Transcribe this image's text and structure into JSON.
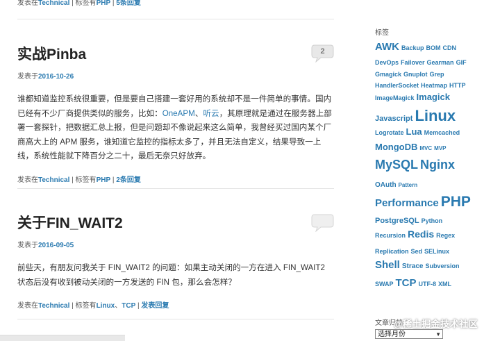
{
  "top_partial": {
    "prefix": "发表在",
    "category": "Technical",
    "tagged": "| 标签有",
    "tag": "PHP",
    "bar": "|",
    "replies": "5条回复"
  },
  "posts": [
    {
      "title_cn": "实战",
      "title_en": "Pinba",
      "date_prefix": "发表于",
      "date": "2016-10-26",
      "comments": "2",
      "excerpt": {
        "part1": "谁都知道监控系统很重要，但是要自己搭建一套好用的系统却不是一件简单的事情。国内已经有不少厂商提供类似的服务，比如：",
        "link1": "OneAPM",
        "sep": "、",
        "link2": "听云",
        "part2": "，其原理就是通过在服务器上部署一套探针，把数据汇总上报，但是问题却不像说起来这么简单，我曾经买过国内某个厂商高大上的 APM 服务，谁知道它监控的指标太多了，并且无法自定义，结果导致一上线，系统性能就下降百分之二十，最后无奈只好放弃。"
      },
      "footer": {
        "prefix": "发表在",
        "category": "Technical",
        "tagged": "| 标签有",
        "tags": [
          "PHP"
        ],
        "bar": "|",
        "replies": "2条回复"
      }
    },
    {
      "title_cn": "关于",
      "title_en": "FIN_WAIT2",
      "date_prefix": "发表于",
      "date": "2016-09-05",
      "comments": "",
      "excerpt": {
        "part1": "前些天，有朋友问我关于 FIN_WAIT2 的问题：如果主动关闭的一方在进入 FIN_WAIT2 状态后没有收到被动关闭的一方发送的 FIN 包，那么会怎样？"
      },
      "footer": {
        "prefix": "发表在",
        "category": "Technical",
        "tagged": "| 标签有",
        "tags": [
          "Linux",
          "TCP"
        ],
        "tag_sep": "、",
        "bar": "|",
        "replies": "发表回复"
      }
    }
  ],
  "sidebar": {
    "tags_title": "标签",
    "tag_rows": [
      [
        {
          "t": "AWK",
          "s": 15
        },
        {
          "t": "Backup",
          "s": 9
        },
        {
          "t": "BOM",
          "s": 9
        },
        {
          "t": "CDN",
          "s": 9
        }
      ],
      [
        {
          "t": "DevOps",
          "s": 9
        },
        {
          "t": "Failover",
          "s": 9
        },
        {
          "t": "Gearman",
          "s": 9
        },
        {
          "t": "GIF",
          "s": 9
        }
      ],
      [
        {
          "t": "Gmagick",
          "s": 9
        },
        {
          "t": "Gnuplot",
          "s": 9
        },
        {
          "t": "Grep",
          "s": 9
        }
      ],
      [
        {
          "t": "HandlerSocket",
          "s": 9
        },
        {
          "t": "Heatmap",
          "s": 9
        },
        {
          "t": "HTTP",
          "s": 9
        }
      ],
      [
        {
          "t": "ImageMagick",
          "s": 9
        },
        {
          "t": "Imagick",
          "s": 13
        }
      ],
      [
        {
          "t": "Javascript",
          "s": 11
        },
        {
          "t": "Linux",
          "s": 22
        }
      ],
      [
        {
          "t": "Logrotate",
          "s": 9
        },
        {
          "t": "Lua",
          "s": 13
        },
        {
          "t": "Memcached",
          "s": 9
        }
      ],
      [
        {
          "t": "MongoDB",
          "s": 13
        },
        {
          "t": "MVC",
          "s": 8
        },
        {
          "t": "MVP",
          "s": 8
        }
      ],
      [
        {
          "t": "MySQL",
          "s": 18
        },
        {
          "t": "Nginx",
          "s": 18
        }
      ],
      [
        {
          "t": "OAuth",
          "s": 10
        },
        {
          "t": "Pattern",
          "s": 8
        }
      ],
      [
        {
          "t": "Performance",
          "s": 15
        },
        {
          "t": "PHP",
          "s": 21
        }
      ],
      [
        {
          "t": "PostgreSQL",
          "s": 11
        },
        {
          "t": "Python",
          "s": 9
        }
      ],
      [
        {
          "t": "Recursion",
          "s": 9
        },
        {
          "t": "Redis",
          "s": 14
        },
        {
          "t": "Regex",
          "s": 9
        }
      ],
      [
        {
          "t": "Replication",
          "s": 9
        },
        {
          "t": "Sed",
          "s": 9
        },
        {
          "t": "SELinux",
          "s": 9
        }
      ],
      [
        {
          "t": "Shell",
          "s": 15
        },
        {
          "t": "Strace",
          "s": 10
        },
        {
          "t": "Subversion",
          "s": 9
        }
      ],
      [
        {
          "t": "SWAP",
          "s": 9
        },
        {
          "t": "TCP",
          "s": 15
        },
        {
          "t": "UTF-8",
          "s": 9
        },
        {
          "t": "XML",
          "s": 9
        }
      ]
    ],
    "archive_title": "文章归档",
    "archive_select": "选择月份"
  },
  "watermark": "@稀土掘金技术社区",
  "colors": {
    "link": "#2a7ab0",
    "text": "#333333",
    "separator": "#e5e5e5"
  }
}
